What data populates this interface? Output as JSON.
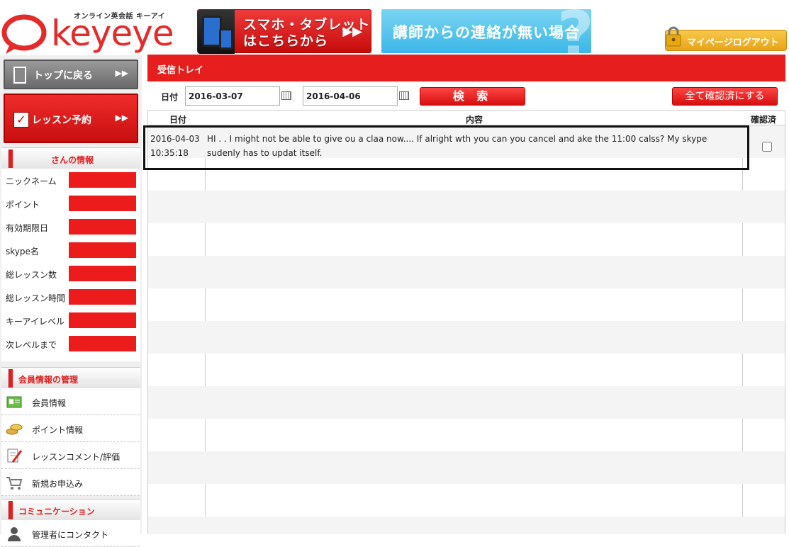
{
  "header": {
    "logo_tag": "オンライン英会話 キーアイ",
    "logo_word": "keyeye",
    "banner_sp_line1": "スマホ・タブレット",
    "banner_sp_line2": "はこちらから",
    "banner_contact": "講師からの連絡が無い場合",
    "logout_label": "マイページログアウト"
  },
  "sidebar": {
    "top_button": "トップに戻る",
    "lesson_button": "レッスン予約",
    "info_heading": "さんの情報",
    "info_rows": [
      {
        "label": "ニックネーム"
      },
      {
        "label": "ポイント"
      },
      {
        "label": "有効期限日"
      },
      {
        "label": "skype名"
      },
      {
        "label": "総レッスン数"
      },
      {
        "label": "総レッスン時間"
      },
      {
        "label": "キーアイレベル"
      },
      {
        "label": "次レベルまで"
      }
    ],
    "member_heading": "会員情報の管理",
    "member_items": [
      {
        "label": "会員情報",
        "icon": "member-card-icon"
      },
      {
        "label": "ポイント情報",
        "icon": "coins-icon"
      },
      {
        "label": "レッスンコメント/評価",
        "icon": "memo-pencil-icon"
      },
      {
        "label": "新規お申込み",
        "icon": "cart-icon"
      }
    ],
    "comm_heading": "コミュニケーション",
    "comm_items": [
      {
        "label": "管理者にコンタクト",
        "icon": "person-icon"
      }
    ]
  },
  "main": {
    "title": "受信トレイ",
    "date_label": "日付",
    "date_from": "2016-03-07",
    "date_to": "2016-04-06",
    "search_button": "検 索",
    "confirm_all_button": "全て確認済にする",
    "columns": [
      "日付",
      "内容",
      "確認済"
    ],
    "messages": [
      {
        "date": "2016-04-03",
        "time": "10:35:18",
        "content": "HI . . I might not be able to give ou  a claa now.... If alright wth you can you  cancel and ake the 11:00 calss? My skype sudenly has to updat itself.",
        "confirmed": false
      }
    ]
  },
  "colors": {
    "brand_red": "#e61e1e",
    "banner_blue": "#3bb7e8",
    "logout_gold": "#f0b030"
  }
}
